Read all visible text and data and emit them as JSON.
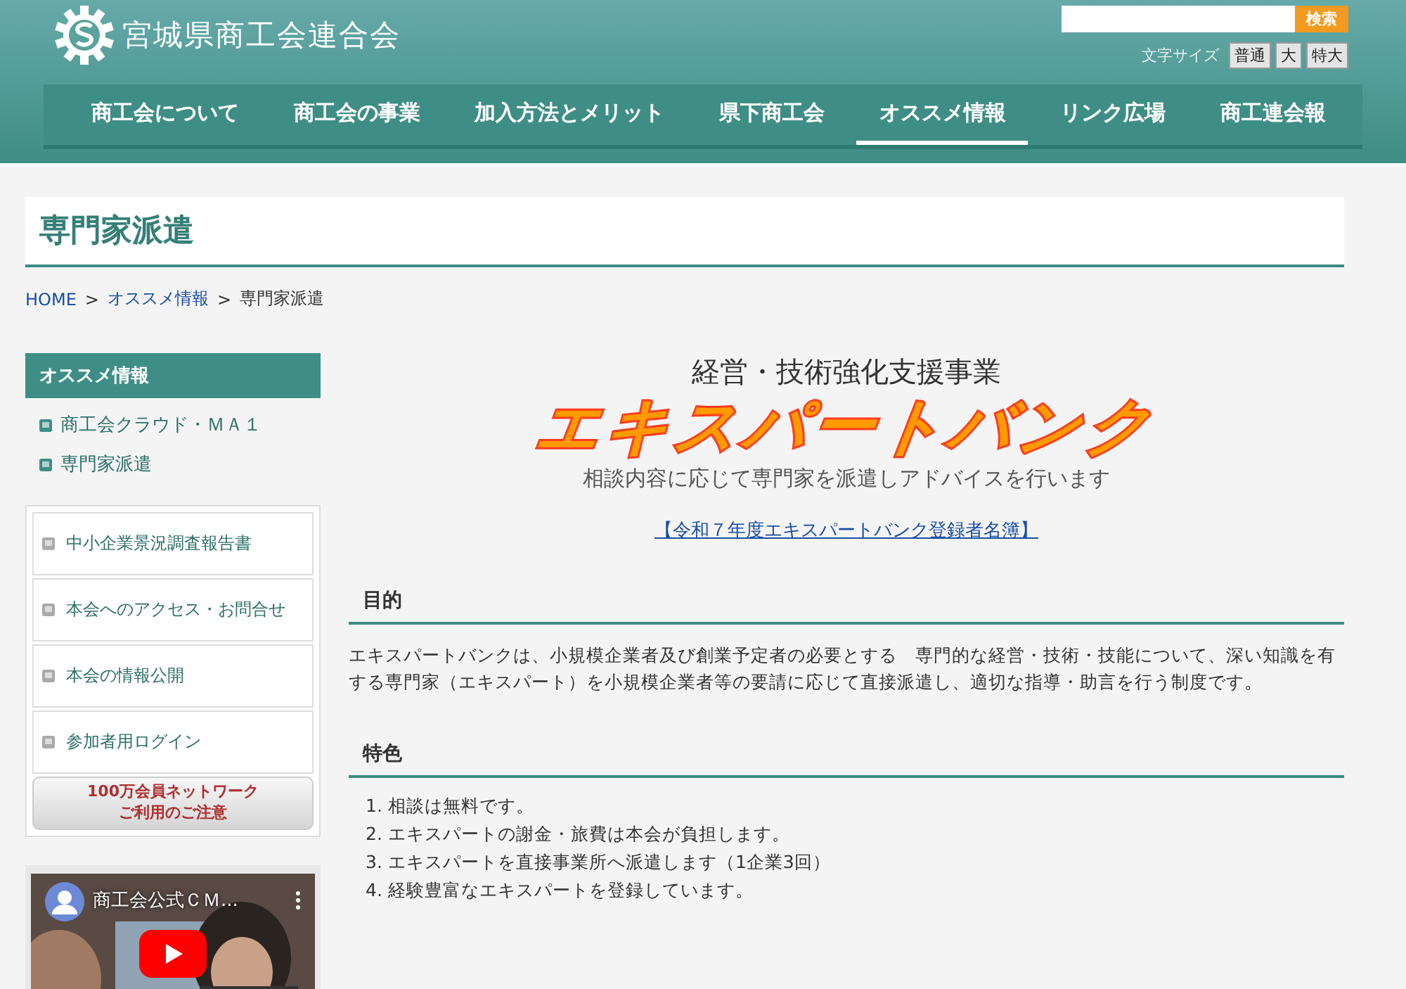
{
  "header": {
    "site_title": "宮城県商工会連合会",
    "search": {
      "button": "検索"
    },
    "font_size": {
      "label": "文字サイズ",
      "options": [
        "普通",
        "大",
        "特大"
      ]
    }
  },
  "nav": [
    {
      "label": "商工会について",
      "selected": false
    },
    {
      "label": "商工会の事業",
      "selected": false
    },
    {
      "label": "加入方法とメリット",
      "selected": false
    },
    {
      "label": "県下商工会",
      "selected": false
    },
    {
      "label": "オススメ情報",
      "selected": true
    },
    {
      "label": "リンク広場",
      "selected": false
    },
    {
      "label": "商工連会報",
      "selected": false
    }
  ],
  "page_title": "専門家派遣",
  "breadcrumb": [
    {
      "label": "HOME",
      "kind": "link"
    },
    {
      "label": ">",
      "kind": "separator"
    },
    {
      "label": "オススメ情報",
      "kind": "link"
    },
    {
      "label": ">",
      "kind": "separator"
    },
    {
      "label": "専門家派遣",
      "kind": "current"
    }
  ],
  "sidebar": {
    "heading": "オススメ情報",
    "links": [
      "商工会クラウド・ＭＡ１",
      "専門家派遣"
    ],
    "menu": [
      "中小企業景況調査報告書",
      "本会へのアクセス・お問合せ",
      "本会の情報公開",
      "参加者用ログイン"
    ],
    "notice_button": [
      "100万会員ネットワーク",
      "ご利用のご注意"
    ],
    "video": {
      "title": "商工会公式ＣＭ..."
    }
  },
  "main": {
    "subtitle": "経営・技術強化支援事業",
    "logo_text": "エキスパートバンク",
    "tagline": "相談内容に応じて専門家を派遣しアドバイスを行います",
    "roster_link": "【令和７年度エキスパートバンク登録者名簿】",
    "sections": [
      {
        "heading": "目的",
        "kind": "paragraph",
        "text": "エキスパートバンクは、小規模企業者及び創業予定者の必要とする　専門的な経営・技術・技能について、深い知識を有する専門家（エキスパート）を小規模企業者等の要請に応じて直接派遣し、適切な指導・助言を行う制度です。"
      },
      {
        "heading": "特色",
        "kind": "list",
        "items": [
          {
            "number": "1.",
            "text": "相談は無料です。"
          },
          {
            "number": "2.",
            "text": "エキスパートの謝金・旅費は本会が負担します。"
          },
          {
            "number": "3.",
            "text": "エキスパートを直接事業所へ派遣します（1企業3回）"
          },
          {
            "number": "4.",
            "text": "経験豊富なエキスパートを登録しています。"
          }
        ]
      }
    ]
  }
}
